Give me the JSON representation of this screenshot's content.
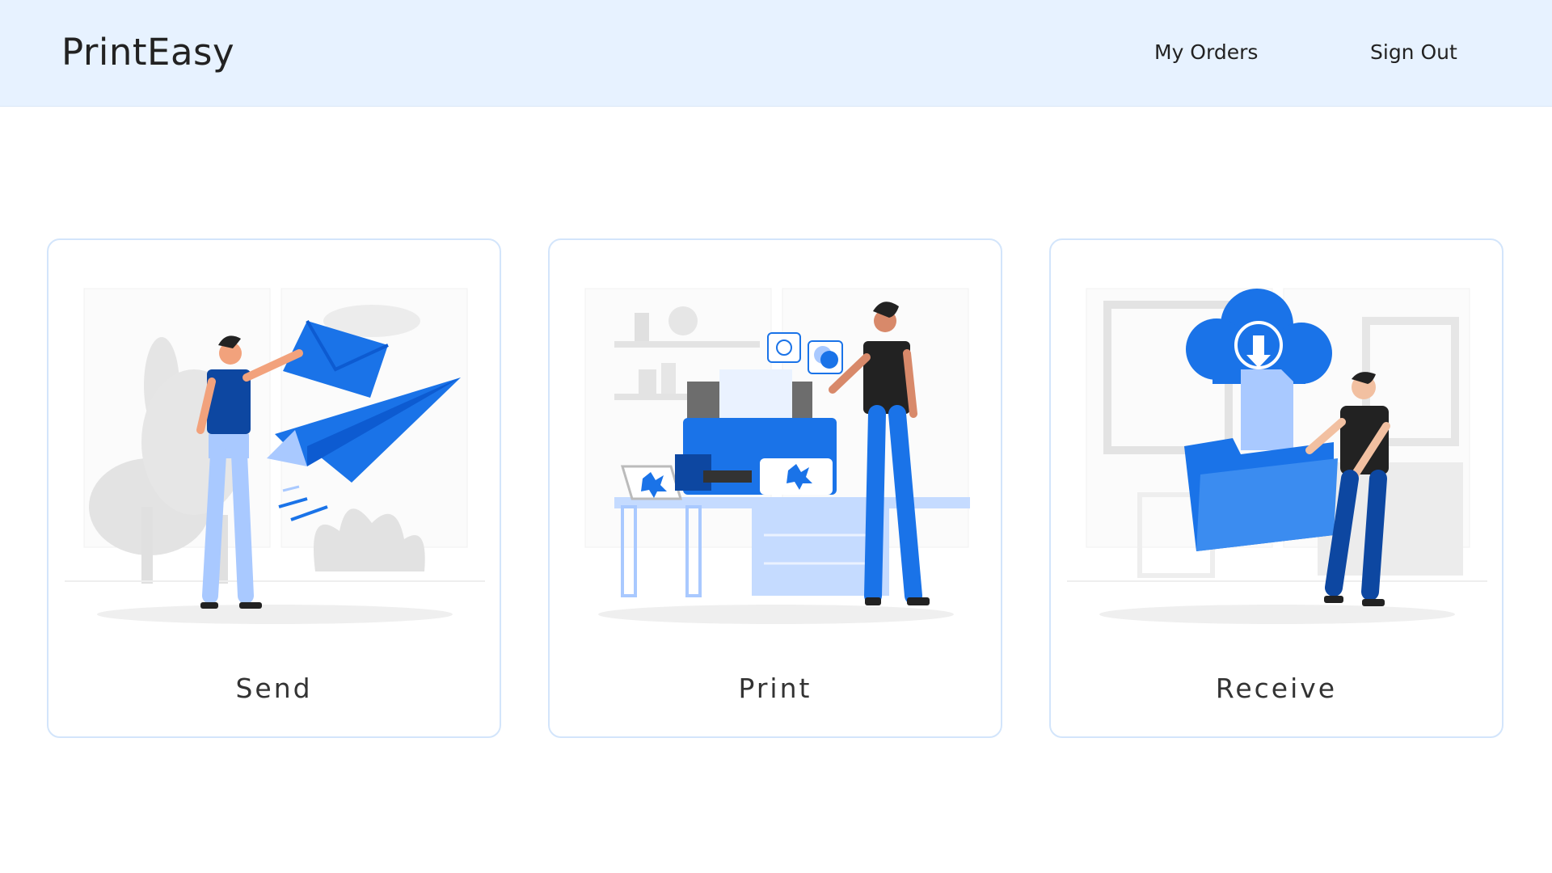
{
  "app": {
    "title": "PrintEasy"
  },
  "nav": {
    "orders": "My Orders",
    "sign_out": "Sign Out"
  },
  "cards": [
    {
      "label": "Send",
      "illustration": "person-launching-envelope-paper-plane"
    },
    {
      "label": "Print",
      "illustration": "person-operating-printer"
    },
    {
      "label": "Receive",
      "illustration": "person-holding-folder-cloud-download"
    }
  ],
  "colors": {
    "header_bg": "#e7f2ff",
    "accent": "#1a73e8",
    "accent_light": "#a9c9ff",
    "card_border": "#d3e5fb",
    "scene_gray": "#e6e6e6"
  }
}
